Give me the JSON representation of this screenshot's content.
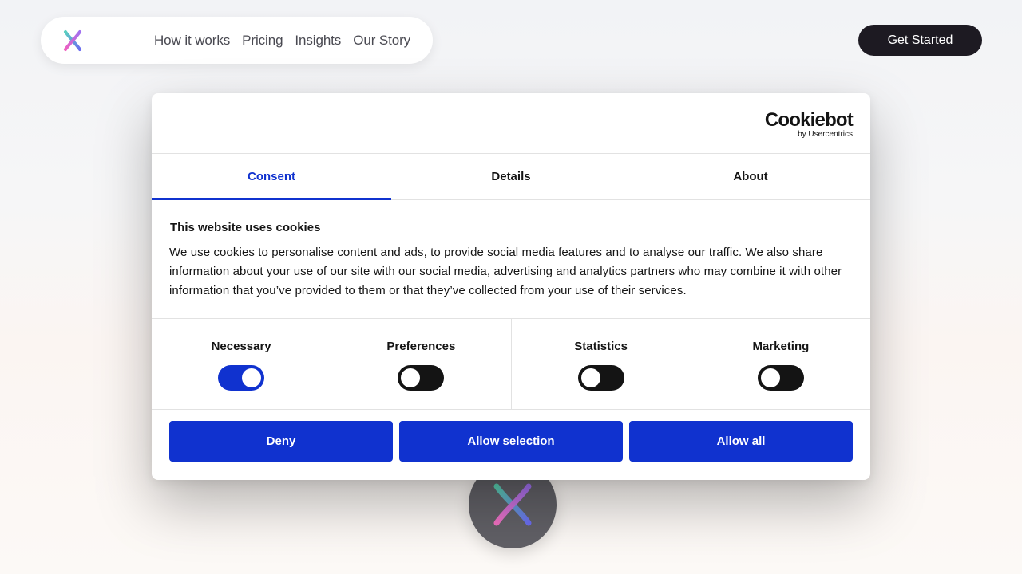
{
  "nav": {
    "logo_icon": "x-logo-icon",
    "links": [
      "How it works",
      "Pricing",
      "Insights",
      "Our Story"
    ],
    "cta_label": "Get Started"
  },
  "cookie": {
    "brand_name": "Cookiebot",
    "brand_sub": "by Usercentrics",
    "tabs": [
      {
        "label": "Consent",
        "active": true
      },
      {
        "label": "Details",
        "active": false
      },
      {
        "label": "About",
        "active": false
      }
    ],
    "title": "This website uses cookies",
    "text": "We use cookies to personalise content and ads, to provide social media features and to analyse our traffic. We also share information about your use of our site with our social media, advertising and analytics partners who may combine it with other information that you’ve provided to them or that they’ve collected from your use of their services.",
    "toggles": [
      {
        "label": "Necessary",
        "on": true
      },
      {
        "label": "Preferences",
        "on": false
      },
      {
        "label": "Statistics",
        "on": false
      },
      {
        "label": "Marketing",
        "on": false
      }
    ],
    "buttons": {
      "deny": "Deny",
      "allow_selection": "Allow selection",
      "allow_all": "Allow all"
    }
  },
  "colors": {
    "accent": "#1032cf",
    "dark": "#1d1a22",
    "toggle_off": "#141414"
  }
}
